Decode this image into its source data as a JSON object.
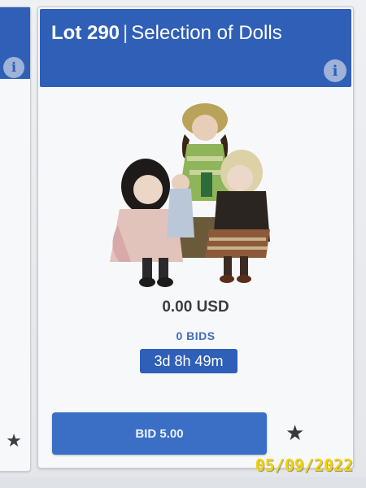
{
  "lot": {
    "number": "Lot 290",
    "separator": "|",
    "title": "Selection of Dolls",
    "info_icon": "info-icon",
    "image": "dolls-photo"
  },
  "auction": {
    "price": "0.00 USD",
    "bids": "0 BIDS",
    "time_left": "3d 8h 49m",
    "bid_button": "BID 5.00",
    "watch_icon": "star-icon"
  },
  "left_card": {
    "info_icon": "info-icon",
    "watch_icon": "star-icon"
  },
  "overlay": {
    "date_stamp": "05/09/2022"
  },
  "colors": {
    "header_blue": "#2f5fb7",
    "button_blue": "#3b6fc6",
    "bids_blue": "#3f6cc0",
    "price_text": "#3a3d43",
    "date_stamp": "#f3d400"
  }
}
